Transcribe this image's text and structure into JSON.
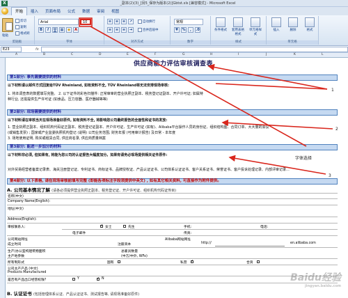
{
  "window": {
    "title": "_副本(2)(3)_[另5_保存为版本(2)]Gbtst.xls [兼容模式] - Microsoft Excel"
  },
  "ribbon": {
    "tabs": [
      "开始",
      "插入",
      "页面布局",
      "公式",
      "数据",
      "审阅",
      "视图"
    ],
    "active_tab": "开始",
    "paste_label": "粘贴",
    "cut_label": "剪切",
    "copy_label": "复制",
    "format_painter_label": "格式刷",
    "font_name": "Arial",
    "font_size": "10",
    "bold": "B",
    "italic": "I",
    "underline": "U",
    "wrap_label": "自动换行",
    "merge_label": "合并后居中",
    "number_format": "常规",
    "conditional_format_label": "条件格式",
    "table_format_label": "套用表格格式",
    "cell_style_label": "单元格样式",
    "insert_label": "插入",
    "delete_label": "删除",
    "format_label": "格式",
    "groups": {
      "clipboard": "剪贴板",
      "font": "字体",
      "alignment": "对齐方式",
      "number": "数字",
      "styles": "样式",
      "cells": "单元格"
    }
  },
  "formula_bar": {
    "name_box": "E23",
    "fx": "fx"
  },
  "columns": [
    "A",
    "B",
    "C",
    "D",
    "E",
    "F",
    "G",
    "H",
    "I",
    "J",
    "K",
    "L"
  ],
  "sheet": {
    "title": "供应商能力评估审核调查表",
    "part1_band": "第1部分: 事先需要提供的材料",
    "part1_line1": "以下材料请以邮件方式回复给TÜV Rheinland, 如有资料不全, TÜV Rheinland将无法安排现场审核:",
    "part1_line2": "1. 将本调查表的数据填写完整。   2. 以下证件的彩色扫描件: 正常审审的营业执照正副本、税务登记证副本、开户许可证; 如属特",
    "part1_line3": "种行业, 还需提供生产许可证 (如食品、压力容器、医疗器械等等)",
    "part2_band": "第2部分: 现场需要提供的材料",
    "part2_line1": "以下材料请在审核当天在现场准备好原件, 如有资料不全, 将影响您公司最终报告的全面性和证书的发放:",
    "part2_line2": "1. 营业执照正副本、组织机构代码证正副本、税务登记证副本、开户许可证、生产许可证 (如有)、Alibaba平台操作人员的身份证、组织结构图、合同订单、大大量的会议",
    "part2_line3": "(或销售发票) ; 国家或产业监委执照机构登记 (说明) 公司业务范围, 财务年报 (可用审计报告) 及日常 - 本年度",
    "part2_line4": "3. 场地使用证明, 购买或租赁合同, 供应商名录, 供应商质量档案",
    "part3_band": "第3部分: 能进一步加分的材料",
    "part3_line1": "以下材料非必须, 但如果有, 将能为您公司的认证报告大幅度加分。如果有请务必现场提供相关证件原件:",
    "part3_line2": "对外贸易经营者备案记录表、海关注册登记证、专利证书、商标证书、品牌授权证、产品认证证书、公司体系认证证书、客户关系证书、荣誉证书、客户投诉处理记录、内部评审记录...",
    "part4_band": "第4部分: 以下表格, 请在现场审核前填写完整 (即能各项标注字段须提供中英文) , 如有其它相关资料, 可直接作为附件提供。",
    "sectionA_title": "A. 公司基本情况了解",
    "sectionA_note": "(请各必须提供营业执照正副本、税务登记证、开户许可证、组织机构代码证传目)",
    "fields": {
      "name_cn": "名称(中文)",
      "company_name_en": "Company Name(English):",
      "address_cn": "地址(中文)",
      "address_en": "Address(English):",
      "contact_person": "审核联系人:",
      "gender_female": "女士",
      "gender_male": "先生",
      "mobile": "手机:",
      "phone": "电话:",
      "email": "电子邮件",
      "fax": "传真:",
      "website": "公司网站网址",
      "url_prefix": "http://",
      "url_suffix": "en.alibaba.com",
      "alibaba_site": "Alibaba网站网址",
      "year_established": "成立时间",
      "registered_capital": "注册资本",
      "office_area": "生产/办公室构建筑物面积",
      "total_employees": "总雇员数量",
      "main_market": "主产地参数",
      "num_employees_note": "(中方/中外, WFo)",
      "ownership": "所有制形式",
      "state_owned": "国有",
      "private": "私营",
      "joint_venture": "合资",
      "main_products_cn": "公司主产产品 (中文)",
      "products_en": "Products Manufactured",
      "export_rights": "是否有产品出口经营权限?",
      "yes_label": "Y",
      "no_label": "N"
    },
    "sectionB_title": "B. 认证证书",
    "sectionB_note": "(包括管理体系认证、产品认证证书、测试报告等, 请现场准备好原件)"
  },
  "annotations": {
    "label1": "1",
    "label2": "2",
    "label3": "3",
    "font_select": "字体选择"
  },
  "watermark": {
    "main": "Baidu经验",
    "sub": "jingyan.baidu.com"
  },
  "colors": {
    "band_fill": "#c5d9f1",
    "band_border": "#4f81bd",
    "annotation_red": "#d9261c"
  }
}
